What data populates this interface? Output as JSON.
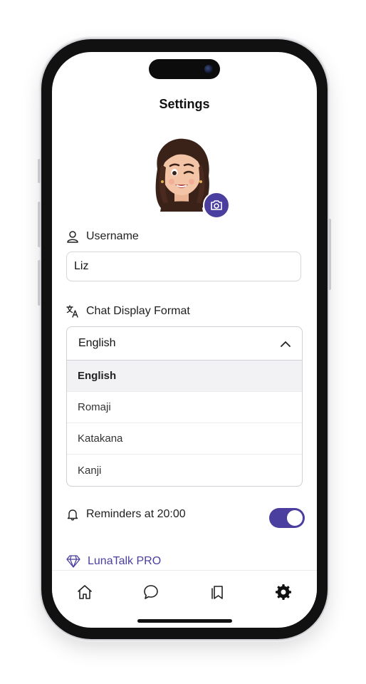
{
  "header": {
    "title": "Settings"
  },
  "profile": {
    "avatar_icon": "memoji-avatar",
    "camera_icon": "camera-icon"
  },
  "username": {
    "label": "Username",
    "value": "Liz",
    "icon": "user-icon"
  },
  "chat_format": {
    "label": "Chat Display Format",
    "icon": "translate-icon",
    "selected": "English",
    "options": [
      "English",
      "Romaji",
      "Katakana",
      "Kanji"
    ]
  },
  "reminders": {
    "label": "Reminders at 20:00",
    "icon": "bell-icon",
    "enabled": true
  },
  "pro": {
    "label": "LunaTalk PRO",
    "icon": "diamond-icon"
  },
  "tabbar": {
    "items": [
      "home-icon",
      "chat-icon",
      "bookmarks-icon",
      "settings-icon"
    ],
    "active": "settings-icon"
  },
  "colors": {
    "accent": "#4a3f9e",
    "text": "#111111",
    "border": "#d6d6db"
  }
}
